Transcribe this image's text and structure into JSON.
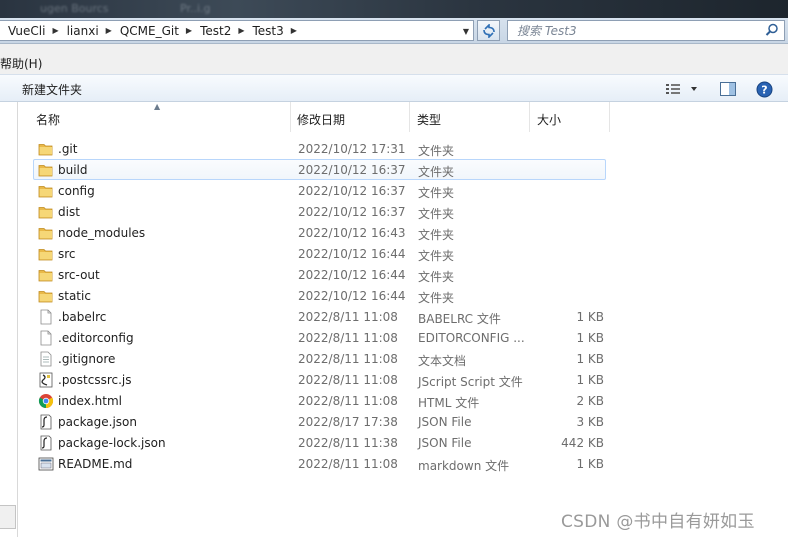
{
  "title_strip": {
    "ghost_left": "ugen Bourcs",
    "ghost_right": "Pr..i.g"
  },
  "breadcrumb": {
    "items": [
      {
        "label": "VueCli"
      },
      {
        "label": "lianxi"
      },
      {
        "label": "QCME_Git"
      },
      {
        "label": "Test2"
      },
      {
        "label": "Test3"
      }
    ]
  },
  "search": {
    "placeholder": "搜索 Test3"
  },
  "menubar": {
    "help": "帮助(H)"
  },
  "toolbar": {
    "new_folder": "新建文件夹"
  },
  "columns": {
    "name": "名称",
    "modified": "修改日期",
    "type": "类型",
    "size": "大小"
  },
  "files": [
    {
      "name": ".git",
      "modified": "2022/10/12 17:31",
      "type": "文件夹",
      "size": "",
      "icon": "folder-icon"
    },
    {
      "name": "build",
      "modified": "2022/10/12 16:37",
      "type": "文件夹",
      "size": "",
      "icon": "folder-icon"
    },
    {
      "name": "config",
      "modified": "2022/10/12 16:37",
      "type": "文件夹",
      "size": "",
      "icon": "folder-icon"
    },
    {
      "name": "dist",
      "modified": "2022/10/12 16:37",
      "type": "文件夹",
      "size": "",
      "icon": "folder-icon"
    },
    {
      "name": "node_modules",
      "modified": "2022/10/12 16:43",
      "type": "文件夹",
      "size": "",
      "icon": "folder-icon"
    },
    {
      "name": "src",
      "modified": "2022/10/12 16:44",
      "type": "文件夹",
      "size": "",
      "icon": "folder-icon"
    },
    {
      "name": "src-out",
      "modified": "2022/10/12 16:44",
      "type": "文件夹",
      "size": "",
      "icon": "folder-icon"
    },
    {
      "name": "static",
      "modified": "2022/10/12 16:44",
      "type": "文件夹",
      "size": "",
      "icon": "folder-icon"
    },
    {
      "name": ".babelrc",
      "modified": "2022/8/11 11:08",
      "type": "BABELRC 文件",
      "size": "1 KB",
      "icon": "blank-file-icon"
    },
    {
      "name": ".editorconfig",
      "modified": "2022/8/11 11:08",
      "type": "EDITORCONFIG ...",
      "size": "1 KB",
      "icon": "blank-file-icon"
    },
    {
      "name": ".gitignore",
      "modified": "2022/8/11 11:08",
      "type": "文本文档",
      "size": "1 KB",
      "icon": "text-file-icon"
    },
    {
      "name": ".postcssrc.js",
      "modified": "2022/8/11 11:08",
      "type": "JScript Script 文件",
      "size": "1 KB",
      "icon": "script-file-icon"
    },
    {
      "name": "index.html",
      "modified": "2022/8/11 11:08",
      "type": "HTML 文件",
      "size": "2 KB",
      "icon": "chrome-icon"
    },
    {
      "name": "package.json",
      "modified": "2022/8/17 17:38",
      "type": "JSON File",
      "size": "3 KB",
      "icon": "json-file-icon"
    },
    {
      "name": "package-lock.json",
      "modified": "2022/8/11 11:38",
      "type": "JSON File",
      "size": "442 KB",
      "icon": "json-file-icon"
    },
    {
      "name": "README.md",
      "modified": "2022/8/11 11:08",
      "type": "markdown 文件",
      "size": "1 KB",
      "icon": "markdown-file-icon"
    }
  ],
  "watermark": "CSDN @书中自有妍如玉"
}
